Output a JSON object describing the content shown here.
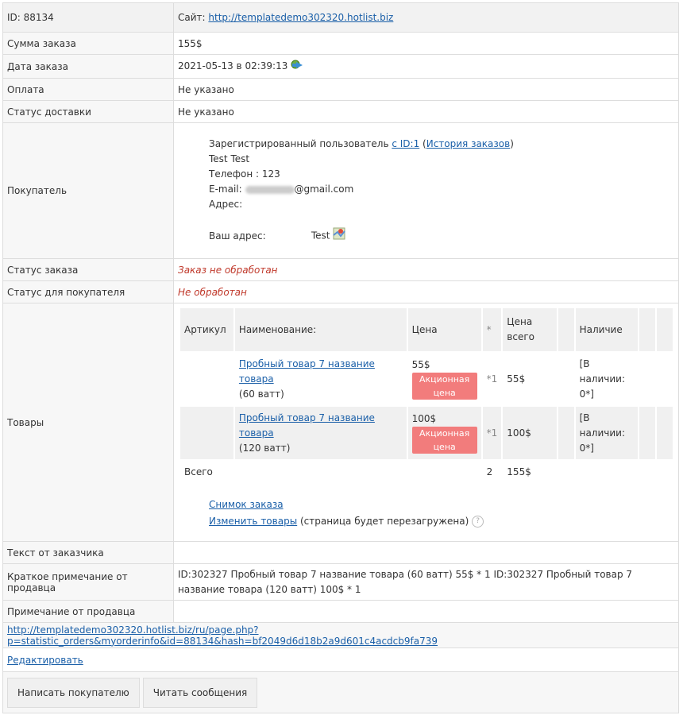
{
  "header": {
    "id_label": "ID: 88134",
    "site_label": "Сайт:",
    "site_url": "http://templatedemo302320.hotlist.biz"
  },
  "rows": {
    "sum_label": "Сумма заказа",
    "sum_value": "155$",
    "date_label": "Дата заказа",
    "date_value": "2021-05-13 в 02:39:13",
    "payment_label": "Оплата",
    "payment_value": "Не указано",
    "delivery_label": "Статус доставки",
    "delivery_value": "Не указано",
    "buyer_label": "Покупатель",
    "order_status_label": "Статус заказа",
    "order_status_value": "Заказ не обработан",
    "buyer_status_label": "Статус для покупателя",
    "buyer_status_value": "Не обработан",
    "goods_label": "Товары",
    "customer_text_label": "Текст от заказчика",
    "seller_short_label": "Краткое примечание от продавца",
    "seller_short_value": "ID:302327 Пробный товар 7 название товара (60 ватт) 55$ * 1 ID:302327 Пробный товар 7 название товара (120 ватт) 100$ * 1",
    "seller_note_label": "Примечание от продавца"
  },
  "buyer": {
    "registered_text": "Зарегистрированный пользователь",
    "id_link": "с ID:1",
    "history_link": "История заказов",
    "name": "Test Test",
    "phone": "Телефон : 123",
    "email_label": "E-mail:",
    "email_domain": "@gmail.com",
    "address_label": "Адрес:",
    "your_address_label": "Ваш адрес:",
    "your_address_value": "Test"
  },
  "goods": {
    "headers": {
      "article": "Артикул",
      "name": "Наименование:",
      "price": "Цена",
      "star": "*",
      "total_price": "Цена всего",
      "availability": "Наличие"
    },
    "items": [
      {
        "name": "Пробный товар 7 название товара",
        "variant": "(60 ватт)",
        "price": "55$",
        "promo": "Акционная цена",
        "qty": "*1",
        "total": "55$",
        "availability": "[В наличии: 0*]"
      },
      {
        "name": "Пробный товар 7 название товара",
        "variant": "(120 ватт)",
        "price": "100$",
        "promo": "Акционная цена",
        "qty": "*1",
        "total": "100$",
        "availability": "[В наличии: 0*]"
      }
    ],
    "total_label": "Всего",
    "total_qty": "2",
    "total_sum": "155$",
    "snapshot_link": "Снимок заказа",
    "edit_goods_link": "Изменить товары",
    "reload_note": "(страница будет перезагружена)",
    "help_icon": "question-icon"
  },
  "footer": {
    "order_url": "http://templatedemo302320.hotlist.biz/ru/page.php?p=statistic_orders&myorderinfo&id=88134&hash=bf2049d6d18b2a9d601c4acdcb9fa739",
    "edit_link": "Редактировать",
    "write_button": "Написать покупателю",
    "read_button": "Читать сообщения"
  },
  "colors": {
    "promo_bg": "#f27c7c",
    "status_red": "#c0392b",
    "link": "#1a5fa8"
  }
}
